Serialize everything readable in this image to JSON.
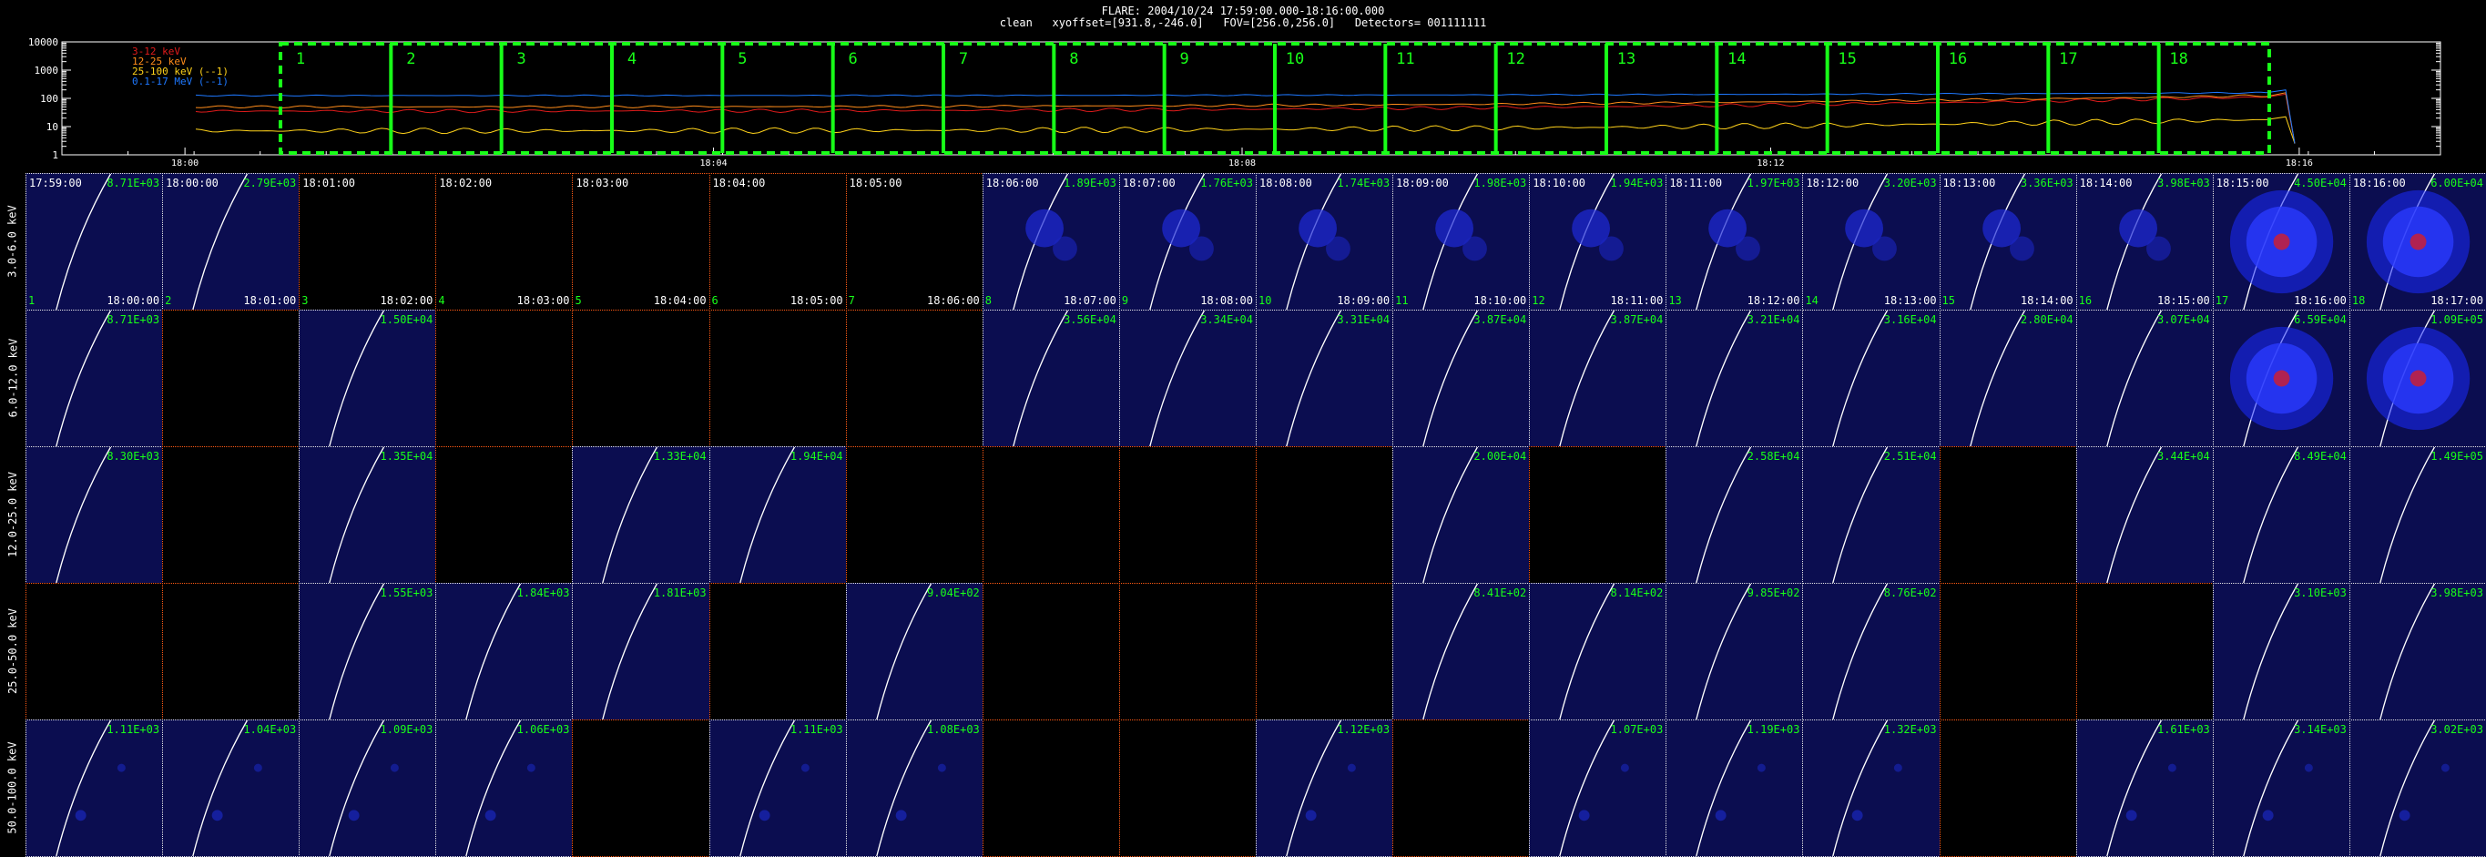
{
  "header": {
    "title": "FLARE: 2004/10/24 17:59:00.000-18:16:00.000",
    "subtitle": "clean   xyoffset=[931.8,-246.0]   FOV=[256.0,256.0]   Detectors= 001111111"
  },
  "lightcurve": {
    "yticks": [
      "10000",
      "1000",
      "100",
      "10",
      "1"
    ],
    "xticks": [
      "18:00",
      "18:04",
      "18:08",
      "18:12",
      "18:16"
    ],
    "legend": [
      {
        "label": "3-12 keV",
        "color": "#e01b1b"
      },
      {
        "label": "12-25 keV",
        "color": "#ff8c1a"
      },
      {
        "label": "25-100 keV (--1)",
        "color": "#ffd21a"
      },
      {
        "label": "0.1-17 MeV (--1)",
        "color": "#1e78ff"
      }
    ],
    "intervals": [
      "1",
      "2",
      "3",
      "4",
      "5",
      "6",
      "7",
      "8",
      "9",
      "10",
      "11",
      "12",
      "13",
      "14",
      "15",
      "16",
      "17",
      "18"
    ],
    "interval_color": "#18ff18"
  },
  "grid": {
    "energy_bands": [
      "3.0-6.0 keV",
      "6.0-12.0 keV",
      "12.0-25.0 keV",
      "25.0-50.0 keV",
      "50.0-100.0 keV"
    ],
    "start_times": [
      "17:59:00",
      "18:00:00",
      "18:01:00",
      "18:02:00",
      "18:03:00",
      "18:04:00",
      "18:05:00",
      "18:06:00",
      "18:07:00",
      "18:08:00",
      "18:09:00",
      "18:10:00",
      "18:11:00",
      "18:12:00",
      "18:13:00",
      "18:14:00",
      "18:15:00",
      "18:16:00"
    ],
    "end_times": [
      "18:00:00",
      "18:01:00",
      "18:02:00",
      "18:03:00",
      "18:04:00",
      "18:05:00",
      "18:06:00",
      "18:07:00",
      "18:08:00",
      "18:09:00",
      "18:10:00",
      "18:11:00",
      "18:12:00",
      "18:13:00",
      "18:14:00",
      "18:15:00",
      "18:16:00",
      "18:17:00"
    ],
    "indices": [
      "1",
      "2",
      "3",
      "4",
      "5",
      "6",
      "7",
      "8",
      "9",
      "10",
      "11",
      "12",
      "13",
      "14",
      "15",
      "16",
      "17",
      "18"
    ],
    "rows": [
      [
        "8.71E+03",
        "2.79E+03",
        "",
        "",
        "",
        "",
        "",
        "1.89E+03",
        "1.76E+03",
        "1.74E+03",
        "1.98E+03",
        "1.94E+03",
        "1.97E+03",
        "3.20E+03",
        "3.36E+03",
        "3.98E+03",
        "4.50E+04",
        "6.00E+04"
      ],
      [
        "8.71E+03",
        "",
        "1.50E+04",
        "",
        "",
        "",
        "",
        "3.56E+04",
        "3.34E+04",
        "3.31E+04",
        "3.87E+04",
        "3.87E+04",
        "3.21E+04",
        "3.16E+04",
        "2.80E+04",
        "3.07E+04",
        "6.59E+04",
        "1.09E+05"
      ],
      [
        "8.30E+03",
        "",
        "1.35E+04",
        "",
        "1.33E+04",
        "1.94E+04",
        "",
        "",
        "",
        "",
        "2.00E+04",
        "",
        "2.58E+04",
        "2.51E+04",
        "",
        "3.44E+04",
        "8.49E+04",
        "1.49E+05"
      ],
      [
        "",
        "",
        "1.55E+03",
        "1.84E+03",
        "1.81E+03",
        "",
        "9.04E+02",
        "",
        "",
        "",
        "8.41E+02",
        "8.14E+02",
        "9.85E+02",
        "8.76E+02",
        "",
        "",
        "3.10E+03",
        "3.98E+03"
      ],
      [
        "1.11E+03",
        "1.04E+03",
        "1.09E+03",
        "1.06E+03",
        "",
        "1.11E+03",
        "1.08E+03",
        "",
        "",
        "1.12E+03",
        "",
        "1.07E+03",
        "1.19E+03",
        "1.32E+03",
        "",
        "1.61E+03",
        "3.14E+03",
        "3.02E+03"
      ]
    ],
    "image_background": "#0b0d50",
    "empty_border": "#ff5a14",
    "label_color": "#18ff18"
  }
}
